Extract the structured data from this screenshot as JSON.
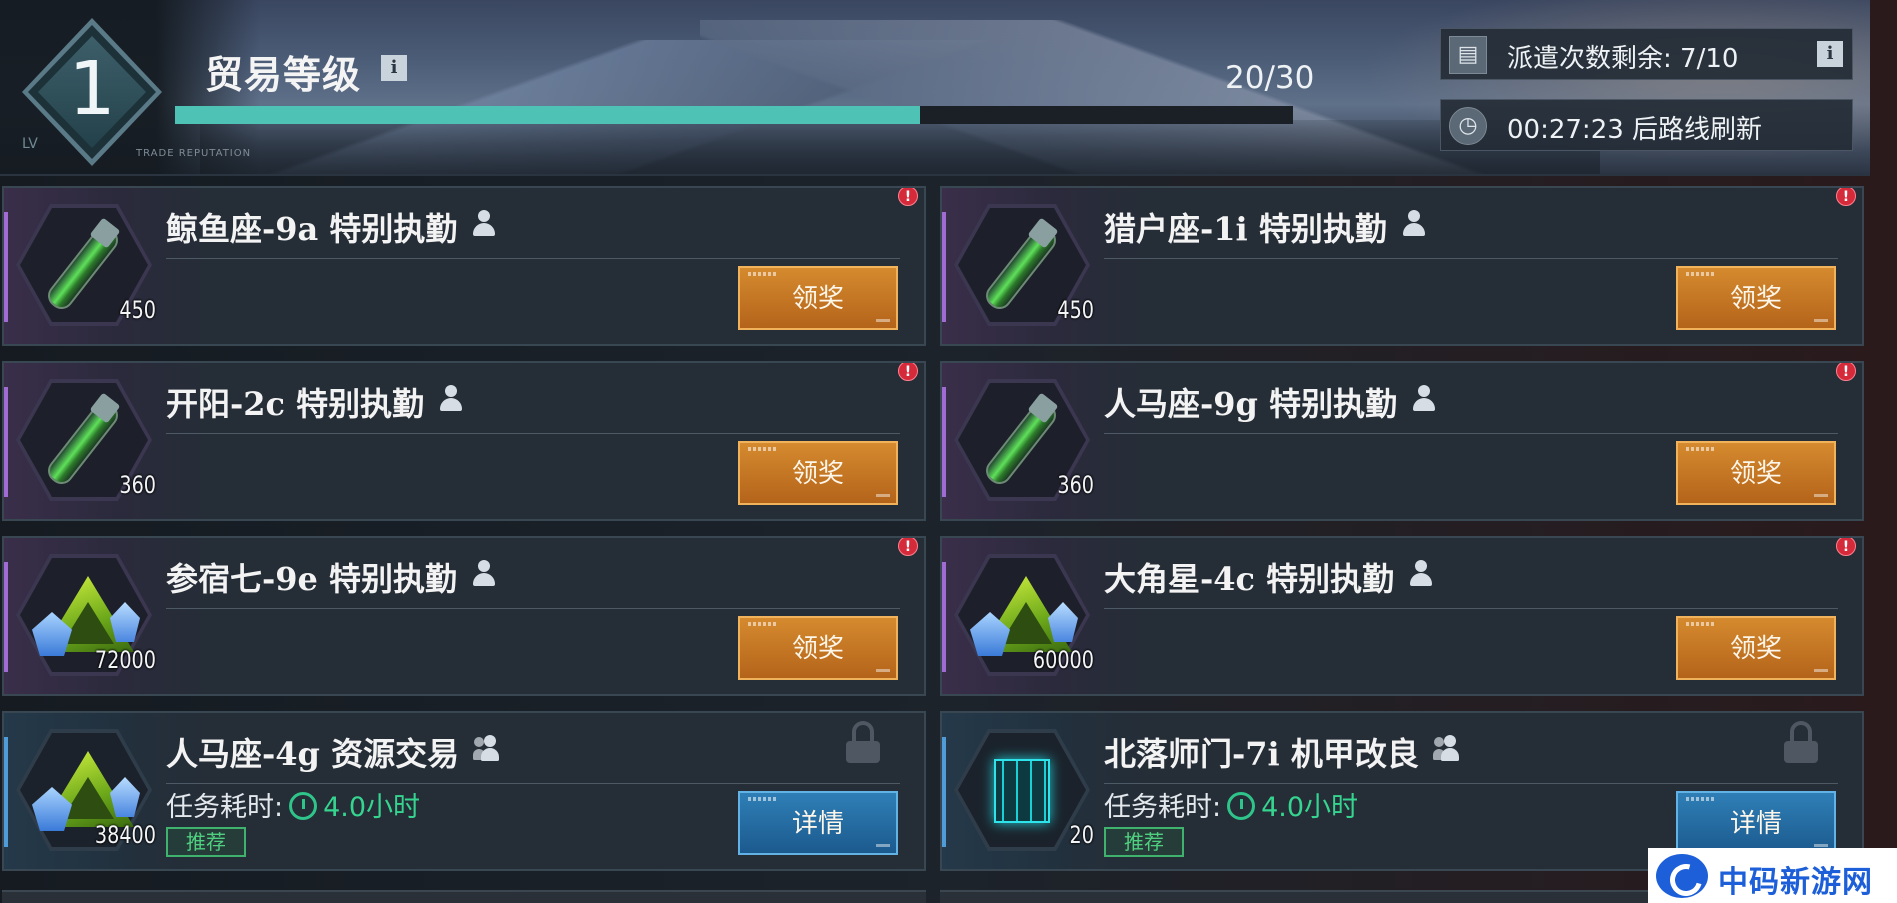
{
  "header": {
    "level": "1",
    "lv_tag": "LV",
    "trade_tag": "TRADE REPUTATION",
    "title": "贸易等级",
    "info_icon": "i",
    "progress_text": "20/30",
    "progress_fraction": 0.6667,
    "dispatch_label": "派遣次数剩余:  7/10",
    "refresh_label": "00:27:23 后路线刷新",
    "dispatch_icon": "clipboard-icon",
    "refresh_icon": "clock-icon"
  },
  "cards": [
    {
      "title": "鲸鱼座-9a  特别执勤",
      "qty": "450",
      "item": "vial",
      "button": "领奖"
    },
    {
      "title": "猎户座-1i  特别执勤",
      "qty": "450",
      "item": "vial",
      "button": "领奖"
    },
    {
      "title": "开阳-2c  特别执勤",
      "qty": "360",
      "item": "vial",
      "button": "领奖"
    },
    {
      "title": "人马座-9g  特别执勤",
      "qty": "360",
      "item": "vial",
      "button": "领奖"
    },
    {
      "title": "参宿七-9e  特别执勤",
      "qty": "72000",
      "item": "crystal",
      "button": "领奖"
    },
    {
      "title": "大角星-4c  特别执勤",
      "qty": "60000",
      "item": "crystal",
      "button": "领奖"
    },
    {
      "title": "人马座-4g  资源交易",
      "qty": "38400",
      "item": "crystal",
      "button": "详情",
      "time_label": "任务耗时:",
      "time_value": "4.0小时",
      "tag": "推荐"
    },
    {
      "title": "北落师门-7i  机甲改良",
      "qty": "20",
      "item": "cube",
      "button": "详情",
      "time_label": "任务耗时:",
      "time_value": "4.0小时",
      "tag": "推荐"
    }
  ],
  "alert_mark": "!",
  "watermark": "中码新游网",
  "colors": {
    "progress": "#4ec2b4",
    "claim_button": "#c97a26",
    "detail_button": "#2a74ab",
    "alert": "#d42a3a",
    "time_green": "#35d48f"
  }
}
